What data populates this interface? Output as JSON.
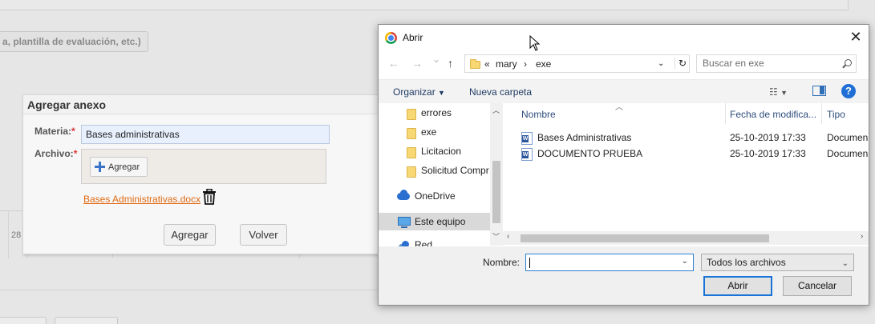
{
  "background": {
    "hint_text": "a, plantilla de evaluación, etc.)",
    "row_number": "28"
  },
  "anexo_dialog": {
    "title": "Agregar anexo",
    "materia_label": "Materia:",
    "materia_value": "Bases administrativas",
    "archivo_label": "Archivo:",
    "required_mark": "*",
    "upload_button": "Agregar",
    "file_link": "Bases Administrativas.docx",
    "submit_button": "Agregar",
    "back_button": "Volver"
  },
  "file_dialog": {
    "title": "Abrir",
    "close": "✕",
    "nav": {
      "back": "←",
      "forward": "→",
      "recent": "⌄",
      "up": "↑"
    },
    "address": {
      "overflow": "«",
      "parts": [
        "mary",
        "exe"
      ],
      "separator": "›"
    },
    "search_placeholder": "Buscar en exe",
    "toolbar": {
      "organize": "Organizar",
      "new_folder": "Nueva carpeta",
      "help": "?"
    },
    "tree": [
      {
        "label": "errores",
        "icon": "folder-icon"
      },
      {
        "label": "exe",
        "icon": "folder-icon"
      },
      {
        "label": "Licitacion",
        "icon": "folder-icon"
      },
      {
        "label": "Solicitud Compr",
        "icon": "folder-icon"
      },
      {
        "label": "OneDrive",
        "icon": "cloud-icon"
      },
      {
        "label": "Este equipo",
        "icon": "pc-icon",
        "selected": true
      },
      {
        "label": "Red",
        "icon": "network-icon"
      }
    ],
    "columns": {
      "name": "Nombre",
      "date": "Fecha de modifica...",
      "type": "Tipo"
    },
    "files": [
      {
        "name": "Bases Administrativas",
        "date": "25-10-2019 17:33",
        "type": "Documen"
      },
      {
        "name": "DOCUMENTO PRUEBA",
        "date": "25-10-2019 17:33",
        "type": "Documen"
      }
    ],
    "filename_label": "Nombre:",
    "filename_value": "",
    "filter_value": "Todos los archivos",
    "open_button": "Abrir",
    "cancel_button": "Cancelar"
  }
}
